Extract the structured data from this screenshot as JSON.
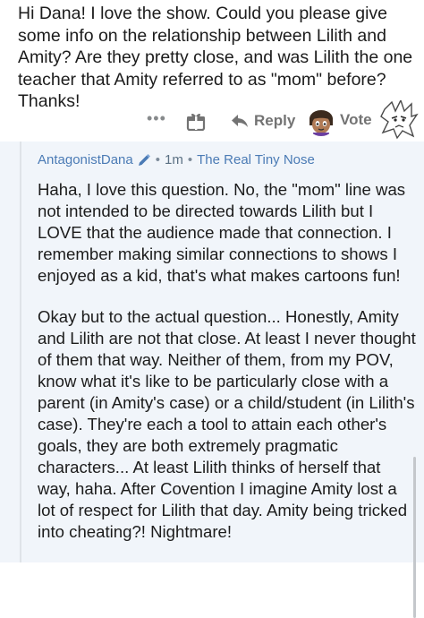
{
  "question": {
    "text": "Hi Dana! I love the show. Could you please give some info on the relationship between Lilith and Amity? Are they pretty close, and was Lilith the one teacher that Amity referred to as \"mom\" before? Thanks!"
  },
  "actions": {
    "more_label": "•••",
    "reply_label": "Reply",
    "vote_label": "Vote"
  },
  "reply": {
    "author": "AntagonistDana",
    "time": "1m",
    "flair": "The Real Tiny Nose",
    "separator": "•",
    "paragraphs": [
      "Haha, I love this question. No, the \"mom\" line was not intended to be directed towards Lilith but I LOVE that the audience made that connection. I remember making similar connections to shows I enjoyed as a kid, that's what makes cartoons fun!",
      "Okay but to the actual question... Honestly, Amity and Lilith are not that close. At least I never thought of them that way. Neither of them, from my POV, know what it's like to be particularly close with a parent (in Amity's case) or a child/student (in Lilith's case). They're each a tool to attain each other's goals, they are both extremely pragmatic characters... At least Lilith thinks of herself that way, haha. After Covention I imagine Amity lost a lot of respect for Lilith that day. Amity being tricked into cheating?! Nightmare!"
    ]
  },
  "colors": {
    "thread_bg": "#f1f5fa",
    "author_link": "#4b7bb5",
    "action_gray": "#737373"
  }
}
